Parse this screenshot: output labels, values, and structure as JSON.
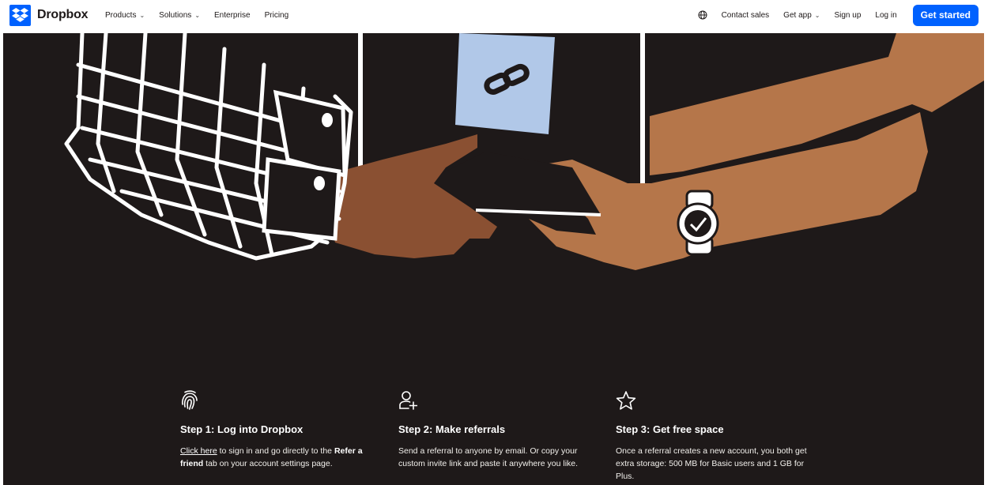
{
  "brand": {
    "name": "Dropbox",
    "accent": "#0061fe",
    "logo_icon": "dropbox-logo-icon"
  },
  "nav": {
    "products": "Products",
    "solutions": "Solutions",
    "enterprise": "Enterprise",
    "pricing": "Pricing",
    "language_icon": "globe-icon",
    "contact_sales": "Contact sales",
    "get_app": "Get app",
    "sign_up": "Sign up",
    "log_in": "Log in",
    "get_started": "Get started"
  },
  "hero": {
    "background": "#1e1919",
    "illustration": "hands-sharing-link-card"
  },
  "steps": [
    {
      "icon": "fingerprint-icon",
      "title": "Step 1: Log into Dropbox",
      "link": "Click here",
      "text_a": " to sign in and go directly to the ",
      "bold": "Refer a friend",
      "text_b": " tab on your account settings page."
    },
    {
      "icon": "add-user-icon",
      "title": "Step 2: Make referrals",
      "text": "Send a referral to anyone by email. Or copy your custom invite link and paste it anywhere you like."
    },
    {
      "icon": "star-icon",
      "title": "Step 3: Get free space",
      "text": "Once a referral creates a new account, you both get extra storage: 500 MB for Basic users and 1 GB for Plus."
    }
  ]
}
